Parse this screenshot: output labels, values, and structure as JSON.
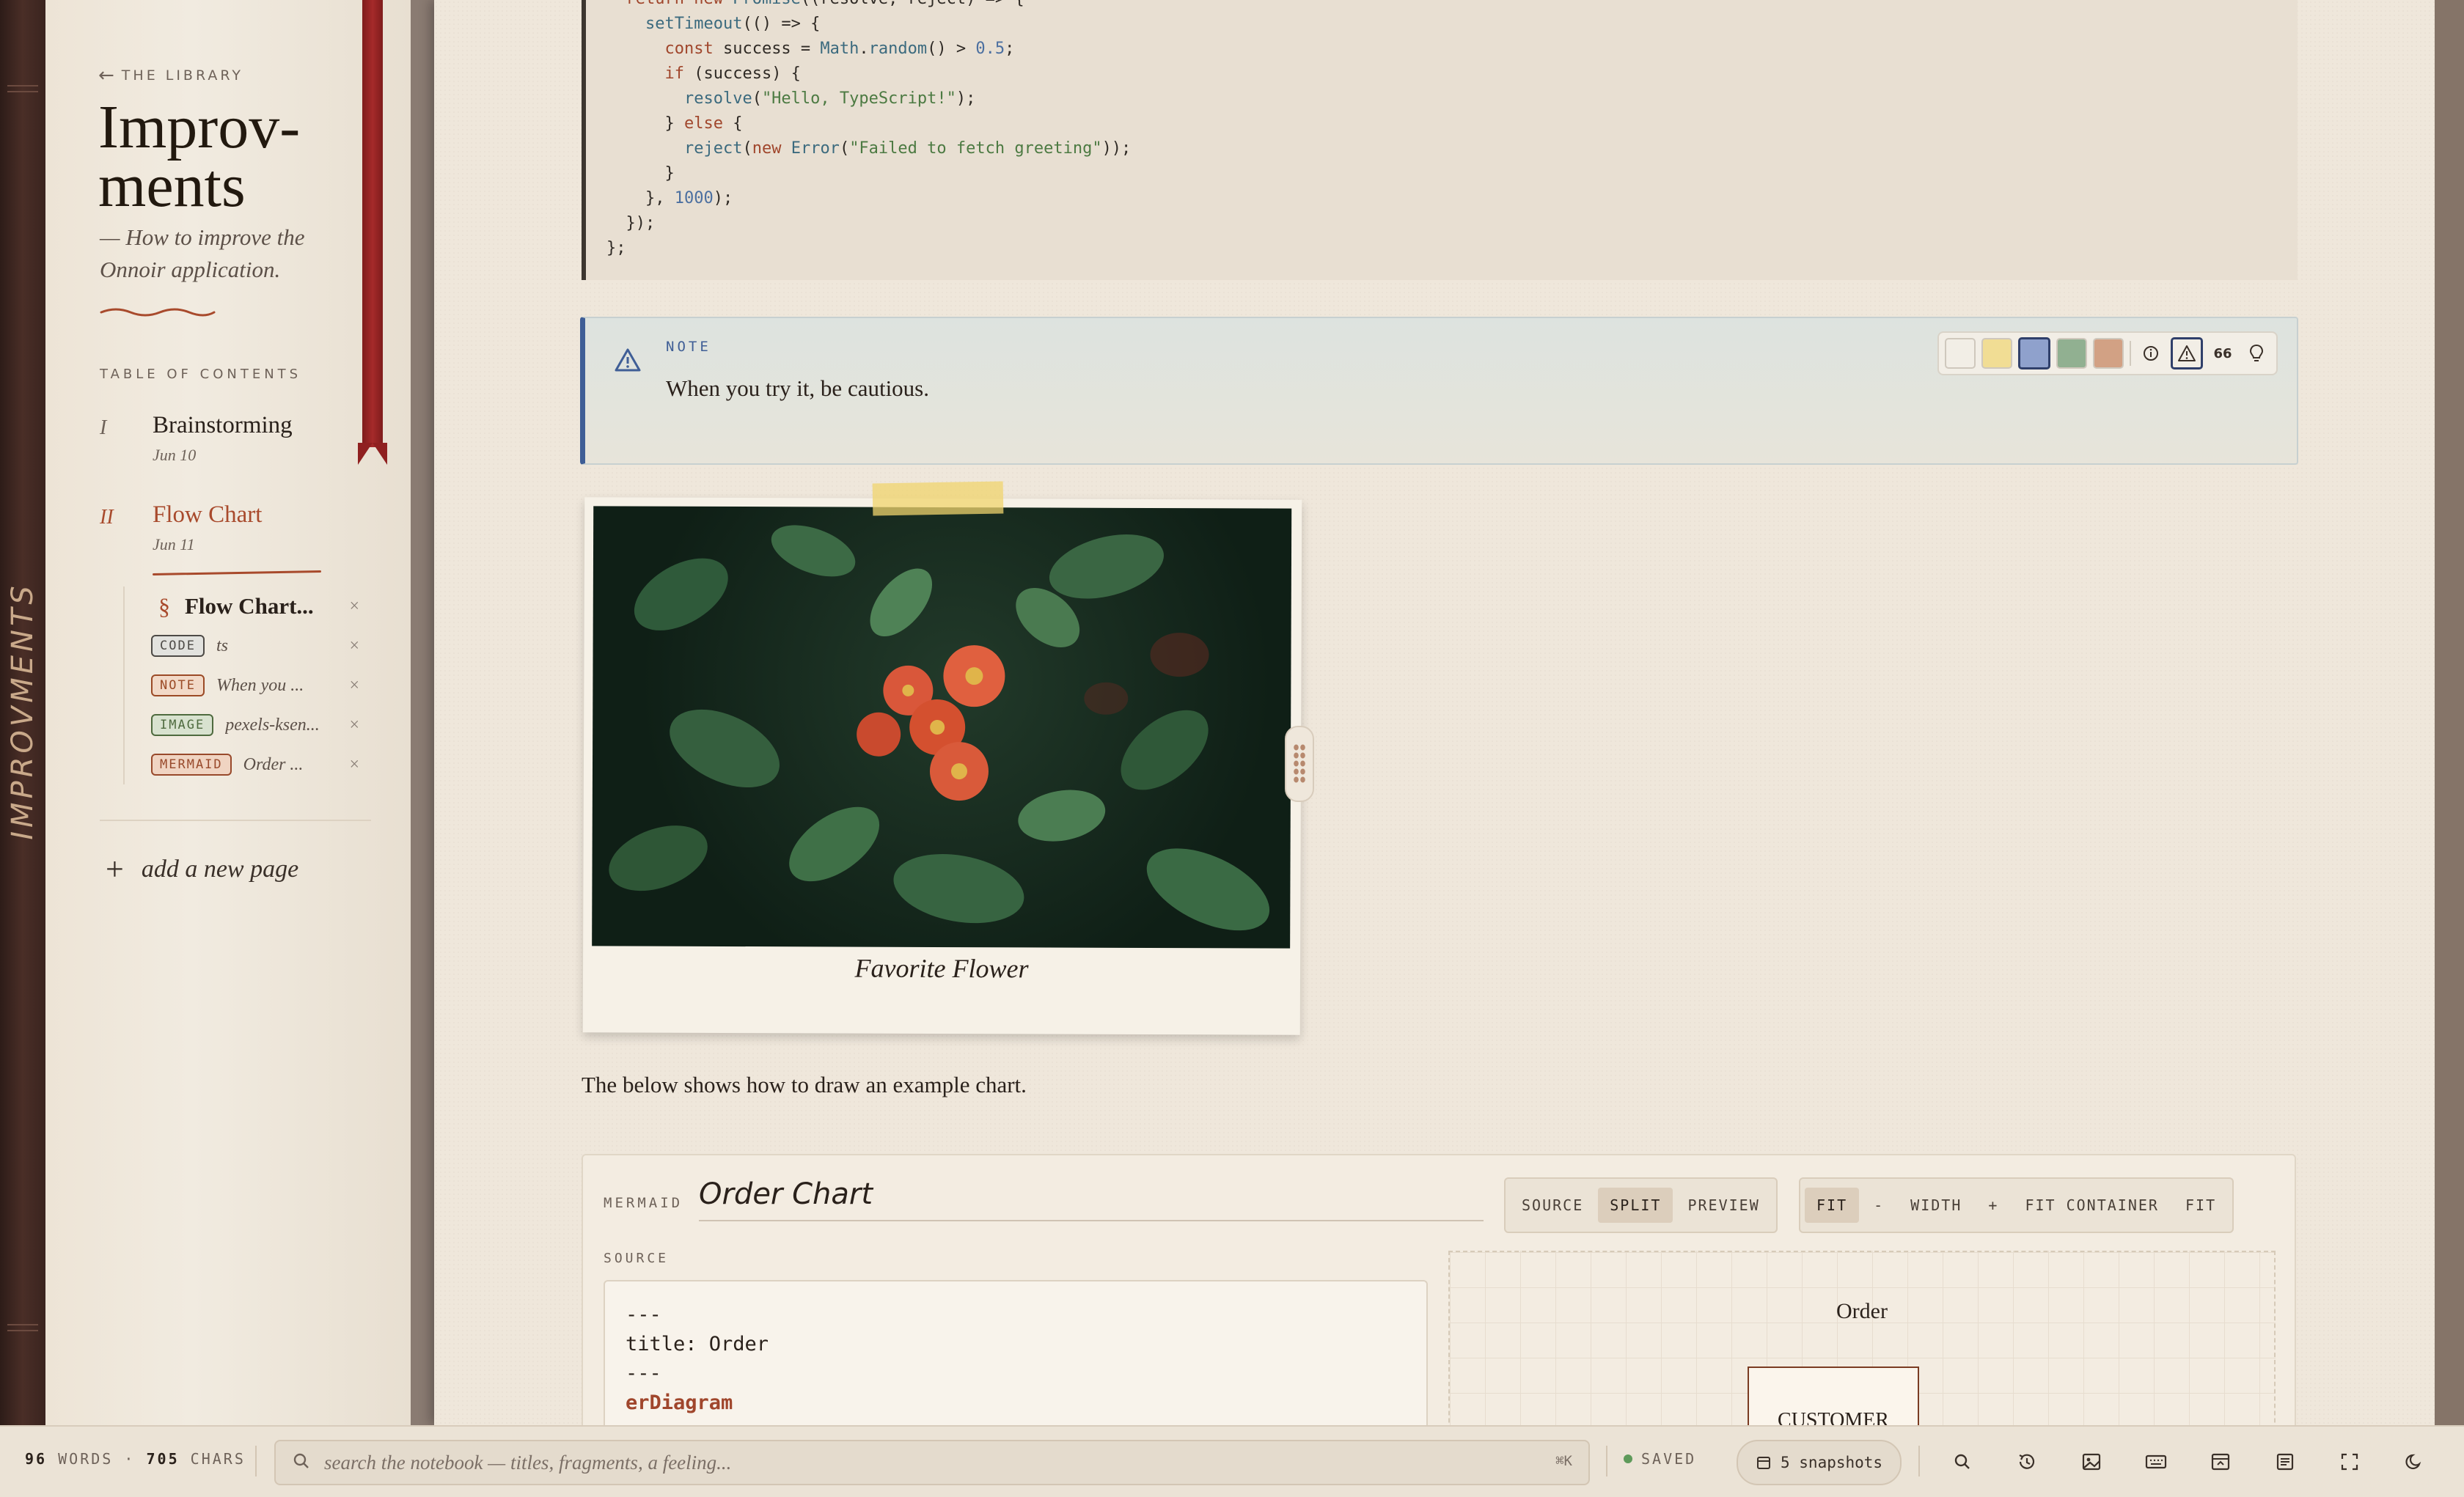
{
  "spine": {
    "title": "IMPROVMENTS"
  },
  "sidebar": {
    "back_label": "THE LIBRARY",
    "title": "Improv-\nments",
    "subtitle": "— How to improve the Onnoir application.",
    "toc_label": "TABLE OF CONTENTS",
    "pages": [
      {
        "num": "I",
        "name": "Brainstorming",
        "date": "Jun 10"
      },
      {
        "num": "II",
        "name": "Flow Chart",
        "date": "Jun 11"
      }
    ],
    "sections": {
      "head": {
        "symbol": "§",
        "title": "Flow Chart..."
      },
      "blocks": [
        {
          "badge": "CODE",
          "text": "ts"
        },
        {
          "badge": "NOTE",
          "text": "When you ..."
        },
        {
          "badge": "IMAGE",
          "text": "pexels-ksen..."
        },
        {
          "badge": "MERMAID",
          "text": "Order ..."
        }
      ]
    },
    "add_page": "add a new page"
  },
  "note": {
    "label": "NOTE",
    "text": "When you try it, be cautious.",
    "swatch_colors": [
      "#f2eee6",
      "#f1dd94",
      "#8fa1cc",
      "#91b091",
      "#d2a184"
    ],
    "icons": [
      "info-icon",
      "warning-icon",
      "quote-icon",
      "bulb-icon"
    ],
    "quote_glyph": "66"
  },
  "image": {
    "caption": "Favorite Flower"
  },
  "paragraph": "The below shows how to draw an example chart.",
  "mermaid": {
    "kind": "MERMAID",
    "title": "Order Chart",
    "view_modes": [
      "SOURCE",
      "SPLIT",
      "PREVIEW"
    ],
    "zoom_controls": [
      "FIT",
      "-",
      "WIDTH",
      "+",
      "FIT CONTAINER",
      "FIT"
    ],
    "source_label": "SOURCE",
    "preview_title": "Order",
    "preview_entity": "CUSTOMER"
  },
  "status": {
    "words": "96",
    "words_label": "WORDS",
    "chars": "705",
    "chars_label": "CHARS",
    "search_placeholder": "search the notebook — titles, fragments, a feeling...",
    "shortcut": "⌘K",
    "saved": "SAVED",
    "snapshots": "5 snapshots"
  },
  "colors": {
    "accent": "#a84a2c",
    "ribbon": "#a52a2a",
    "note_border": "#3f5e96",
    "saved_dot": "#5e9a5a"
  }
}
